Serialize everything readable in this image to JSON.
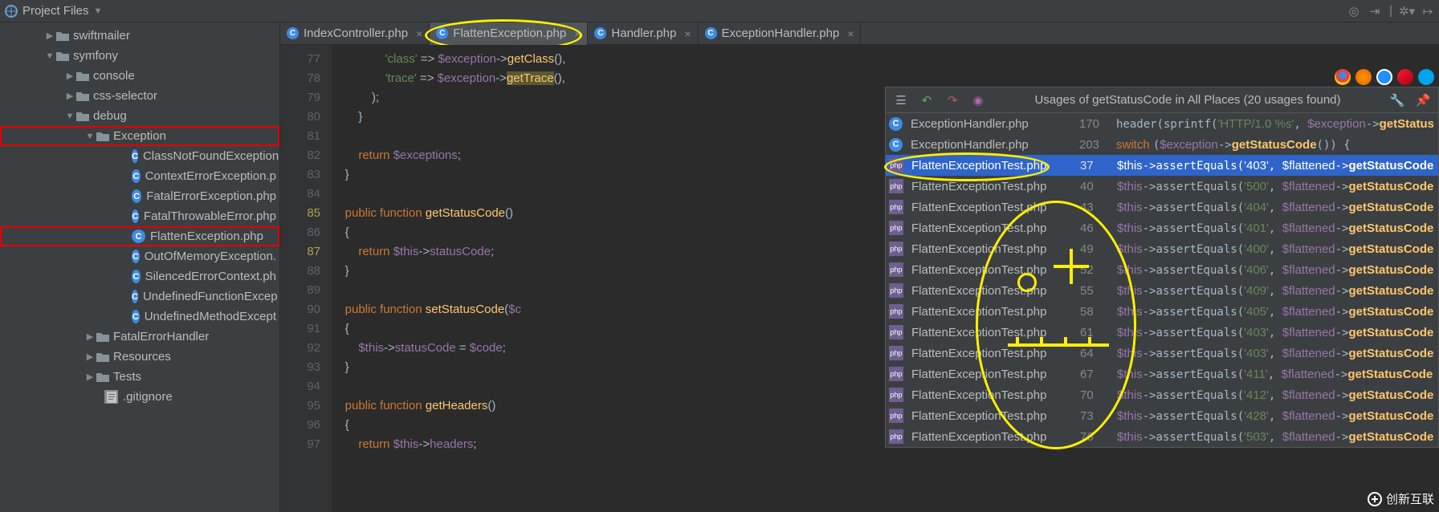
{
  "topbar": {
    "title": "Project Files"
  },
  "tree": {
    "items": [
      {
        "indent": 55,
        "arrow": "▶",
        "icon": "folder",
        "label": "swiftmailer"
      },
      {
        "indent": 55,
        "arrow": "▼",
        "icon": "folder",
        "label": "symfony"
      },
      {
        "indent": 80,
        "arrow": "▶",
        "icon": "folder",
        "label": "console"
      },
      {
        "indent": 80,
        "arrow": "▶",
        "icon": "folder",
        "label": "css-selector"
      },
      {
        "indent": 80,
        "arrow": "▼",
        "icon": "folder",
        "label": "debug"
      },
      {
        "indent": 105,
        "arrow": "▼",
        "icon": "folder",
        "label": "Exception",
        "redbox": true
      },
      {
        "indent": 164,
        "icon": "c",
        "label": "ClassNotFoundException."
      },
      {
        "indent": 164,
        "icon": "c",
        "label": "ContextErrorException.p"
      },
      {
        "indent": 164,
        "icon": "c",
        "label": "FatalErrorException.php"
      },
      {
        "indent": 164,
        "icon": "c",
        "label": "FatalThrowableError.php"
      },
      {
        "indent": 164,
        "icon": "c",
        "label": "FlattenException.php",
        "redbox": true
      },
      {
        "indent": 164,
        "icon": "c",
        "label": "OutOfMemoryException."
      },
      {
        "indent": 164,
        "icon": "c",
        "label": "SilencedErrorContext.ph"
      },
      {
        "indent": 164,
        "icon": "c",
        "label": "UndefinedFunctionExcep"
      },
      {
        "indent": 164,
        "icon": "c",
        "label": "UndefinedMethodExcept"
      },
      {
        "indent": 105,
        "arrow": "▶",
        "icon": "folder",
        "label": "FatalErrorHandler"
      },
      {
        "indent": 105,
        "arrow": "▶",
        "icon": "folder",
        "label": "Resources"
      },
      {
        "indent": 105,
        "arrow": "▶",
        "icon": "folder",
        "label": "Tests"
      },
      {
        "indent": 130,
        "icon": "txt",
        "label": ".gitignore"
      }
    ]
  },
  "tabs": [
    {
      "label": "IndexController.php",
      "close": true
    },
    {
      "label": "FlattenException.php",
      "close": true,
      "active": true,
      "circle": true
    },
    {
      "label": "Handler.php",
      "close": true
    },
    {
      "label": "ExceptionHandler.php",
      "close": true
    }
  ],
  "gutter": [
    "77",
    "78",
    "79",
    "80",
    "81",
    "82",
    "83",
    "84",
    "85",
    "86",
    "87",
    "88",
    "89",
    "90",
    "91",
    "92",
    "93",
    "94",
    "95",
    "96",
    "97"
  ],
  "gutter_yellow": [
    "85",
    "87"
  ],
  "find": {
    "title": "Usages of getStatusCode in All Places (20 usages found)",
    "rows": [
      {
        "icon": "c",
        "file": "ExceptionHandler.php",
        "line": "170",
        "snip": [
          "header(sprintf(",
          [
            "s",
            "'HTTP/1.0 %s'"
          ],
          ", ",
          [
            "v",
            "$exception"
          ],
          "->",
          [
            "b",
            "getStatusCode"
          ],
          "()));"
        ]
      },
      {
        "icon": "c",
        "file": "ExceptionHandler.php",
        "line": "203",
        "snip": [
          [
            "k",
            "switch "
          ],
          "(",
          [
            "v",
            "$exception"
          ],
          "->",
          [
            "b",
            "getStatusCode"
          ],
          "()) {"
        ]
      },
      {
        "icon": "php",
        "file": "FlattenExceptionTest.php",
        "line": "37",
        "sel": true,
        "circle": true,
        "snip": [
          [
            "v",
            "$this"
          ],
          "->assertEquals(",
          [
            "s",
            "'403'"
          ],
          ", ",
          [
            "v",
            "$flattened"
          ],
          "->",
          [
            "b",
            "getStatusCode"
          ],
          "());"
        ]
      },
      {
        "icon": "php",
        "file": "FlattenExceptionTest.php",
        "line": "40",
        "snip": [
          [
            "v",
            "$this"
          ],
          "->assertEquals(",
          [
            "s",
            "'500'"
          ],
          ", ",
          [
            "v",
            "$flattened"
          ],
          "->",
          [
            "b",
            "getStatusCode"
          ],
          "());"
        ]
      },
      {
        "icon": "php",
        "file": "FlattenExceptionTest.php",
        "line": "43",
        "snip": [
          [
            "v",
            "$this"
          ],
          "->assertEquals(",
          [
            "s",
            "'404'"
          ],
          ", ",
          [
            "v",
            "$flattened"
          ],
          "->",
          [
            "b",
            "getStatusCode"
          ],
          "());"
        ]
      },
      {
        "icon": "php",
        "file": "FlattenExceptionTest.php",
        "line": "46",
        "snip": [
          [
            "v",
            "$this"
          ],
          "->assertEquals(",
          [
            "s",
            "'401'"
          ],
          ", ",
          [
            "v",
            "$flattened"
          ],
          "->",
          [
            "b",
            "getStatusCode"
          ],
          "());"
        ]
      },
      {
        "icon": "php",
        "file": "FlattenExceptionTest.php",
        "line": "49",
        "snip": [
          [
            "v",
            "$this"
          ],
          "->assertEquals(",
          [
            "s",
            "'400'"
          ],
          ", ",
          [
            "v",
            "$flattened"
          ],
          "->",
          [
            "b",
            "getStatusCode"
          ],
          "());"
        ]
      },
      {
        "icon": "php",
        "file": "FlattenExceptionTest.php",
        "line": "52",
        "snip": [
          [
            "v",
            "$this"
          ],
          "->assertEquals(",
          [
            "s",
            "'406'"
          ],
          ", ",
          [
            "v",
            "$flattened"
          ],
          "->",
          [
            "b",
            "getStatusCode"
          ],
          "());"
        ]
      },
      {
        "icon": "php",
        "file": "FlattenExceptionTest.php",
        "line": "55",
        "snip": [
          [
            "v",
            "$this"
          ],
          "->assertEquals(",
          [
            "s",
            "'409'"
          ],
          ", ",
          [
            "v",
            "$flattened"
          ],
          "->",
          [
            "b",
            "getStatusCode"
          ],
          "());"
        ]
      },
      {
        "icon": "php",
        "file": "FlattenExceptionTest.php",
        "line": "58",
        "snip": [
          [
            "v",
            "$this"
          ],
          "->assertEquals(",
          [
            "s",
            "'405'"
          ],
          ", ",
          [
            "v",
            "$flattened"
          ],
          "->",
          [
            "b",
            "getStatusCode"
          ],
          "());"
        ]
      },
      {
        "icon": "php",
        "file": "FlattenExceptionTest.php",
        "line": "61",
        "snip": [
          [
            "v",
            "$this"
          ],
          "->assertEquals(",
          [
            "s",
            "'403'"
          ],
          ", ",
          [
            "v",
            "$flattened"
          ],
          "->",
          [
            "b",
            "getStatusCode"
          ],
          "());"
        ]
      },
      {
        "icon": "php",
        "file": "FlattenExceptionTest.php",
        "line": "64",
        "snip": [
          [
            "v",
            "$this"
          ],
          "->assertEquals(",
          [
            "s",
            "'403'"
          ],
          ", ",
          [
            "v",
            "$flattened"
          ],
          "->",
          [
            "b",
            "getStatusCode"
          ],
          "());"
        ]
      },
      {
        "icon": "php",
        "file": "FlattenExceptionTest.php",
        "line": "67",
        "snip": [
          [
            "v",
            "$this"
          ],
          "->assertEquals(",
          [
            "s",
            "'411'"
          ],
          ", ",
          [
            "v",
            "$flattened"
          ],
          "->",
          [
            "b",
            "getStatusCode"
          ],
          "());"
        ]
      },
      {
        "icon": "php",
        "file": "FlattenExceptionTest.php",
        "line": "70",
        "snip": [
          [
            "v",
            "$this"
          ],
          "->assertEquals(",
          [
            "s",
            "'412'"
          ],
          ", ",
          [
            "v",
            "$flattened"
          ],
          "->",
          [
            "b",
            "getStatusCode"
          ],
          "());"
        ]
      },
      {
        "icon": "php",
        "file": "FlattenExceptionTest.php",
        "line": "73",
        "snip": [
          [
            "v",
            "$this"
          ],
          "->assertEquals(",
          [
            "s",
            "'428'"
          ],
          ", ",
          [
            "v",
            "$flattened"
          ],
          "->",
          [
            "b",
            "getStatusCode"
          ],
          "());"
        ]
      },
      {
        "icon": "php",
        "file": "FlattenExceptionTest.php",
        "line": "76",
        "snip": [
          [
            "v",
            "$this"
          ],
          "->assertEquals(",
          [
            "s",
            "'503'"
          ],
          ", ",
          [
            "v",
            "$flattened"
          ],
          "->",
          [
            "b",
            "getStatusCode"
          ],
          "());"
        ]
      }
    ]
  },
  "watermark": "创新互联"
}
